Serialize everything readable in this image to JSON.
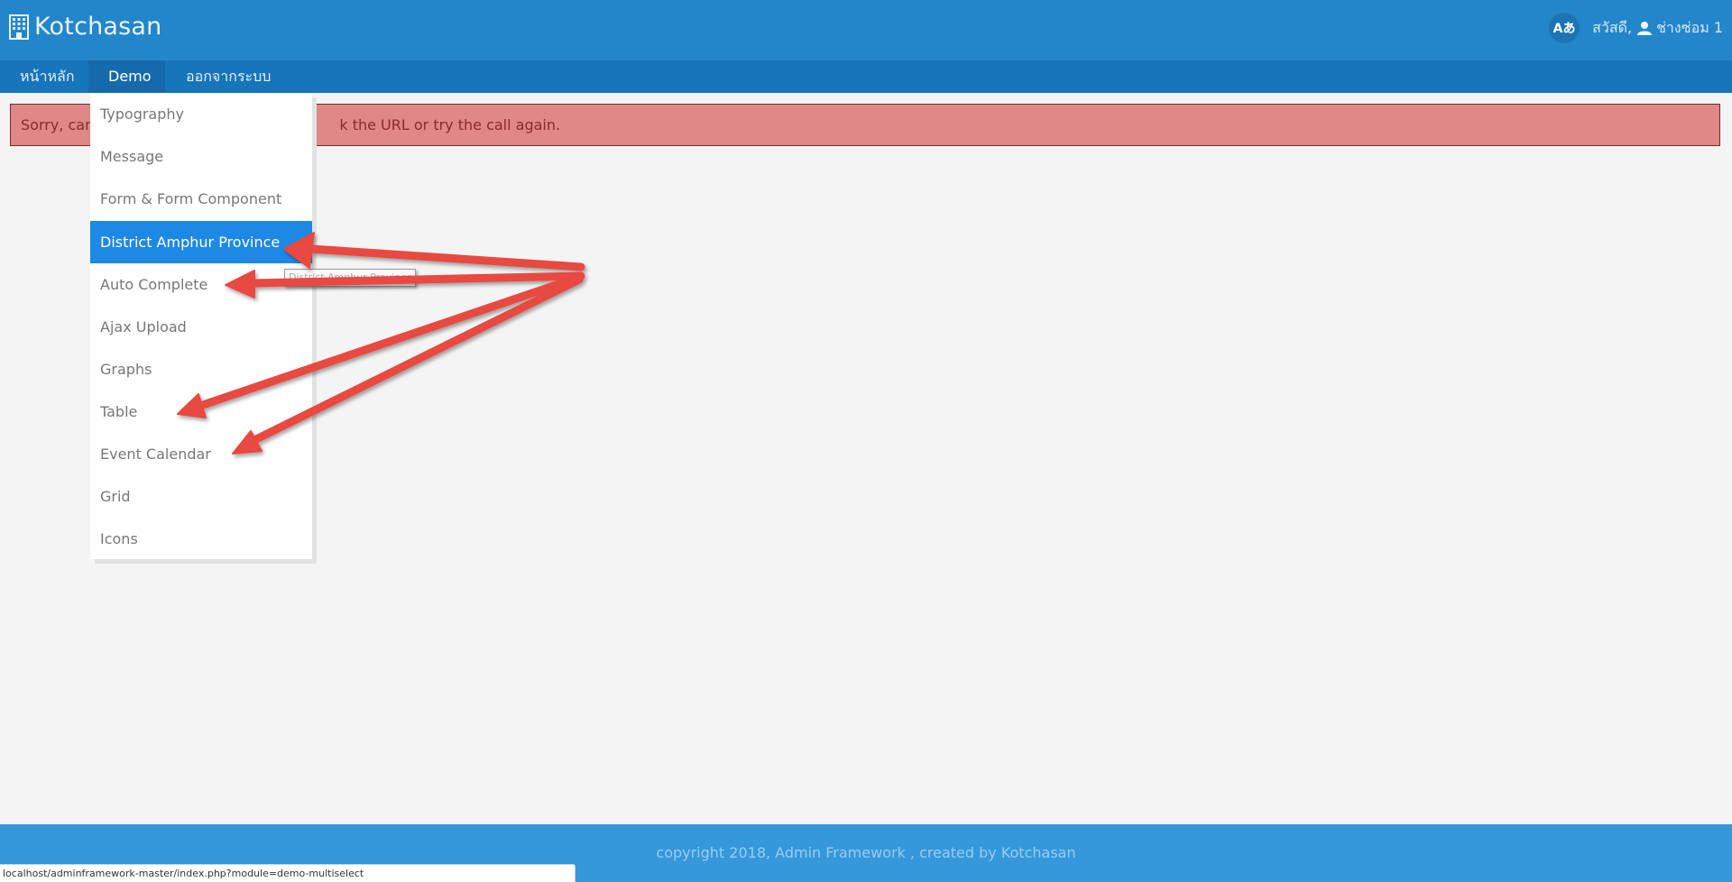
{
  "header": {
    "brand": "Kotchasan",
    "brand_icon": "building-icon",
    "language_button": "Aあ",
    "greeting": "สวัสดี,",
    "user_icon": "user-icon",
    "username": "ช่างซ่อม 1"
  },
  "nav": {
    "items": [
      {
        "label": "หน้าหลัก"
      },
      {
        "label": "Demo",
        "has_dropdown": true,
        "active": true
      },
      {
        "label": "ออกจากระบบ"
      }
    ]
  },
  "alert": {
    "text": "Sorry, cannot find a page called Please check the URL or try the call again.",
    "visible_left": "Sorry, cann",
    "visible_right": "k the URL or try the call again."
  },
  "dropdown": {
    "items": [
      {
        "label": "Typography"
      },
      {
        "label": "Message"
      },
      {
        "label": "Form & Form Component"
      },
      {
        "label": "District Amphur Province",
        "highlighted": true
      },
      {
        "label": "Auto Complete"
      },
      {
        "label": "Ajax Upload"
      },
      {
        "label": "Graphs"
      },
      {
        "label": "Table"
      },
      {
        "label": "Event Calendar"
      },
      {
        "label": "Grid"
      },
      {
        "label": "Icons"
      }
    ]
  },
  "tooltip": {
    "text": "District Amphur Province"
  },
  "annotation": {
    "color": "#e8483f",
    "arrow_targets": [
      "District Amphur Province",
      "Auto Complete",
      "Table",
      "Event Calendar"
    ]
  },
  "footer": {
    "text": "copyright 2018, Admin Framework , created by Kotchasan"
  },
  "statusbar": {
    "url": "localhost/adminframework-master/index.php?module=demo-multiselect"
  }
}
